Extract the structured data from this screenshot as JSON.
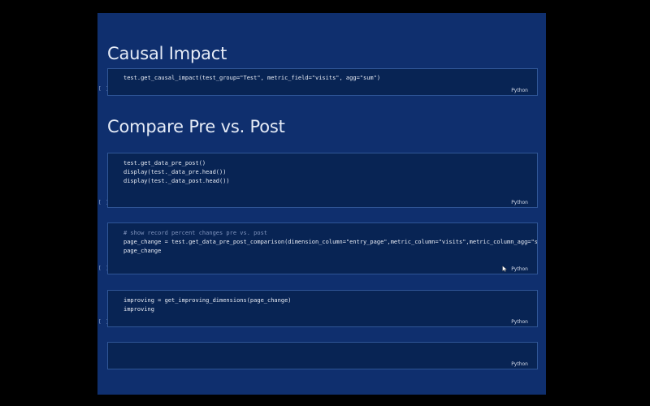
{
  "sections": [
    {
      "heading": "Causal Impact"
    },
    {
      "heading": "Compare Pre vs. Post"
    }
  ],
  "cells": [
    {
      "bracket": "[ ]",
      "lines": [
        "test.get_causal_impact(test_group=\"Test\", metric_field=\"visits\", agg=\"sum\")"
      ],
      "language": "Python"
    },
    {
      "bracket": "[ ]",
      "lines": [
        "test.get_data_pre_post()",
        "display(test._data_pre.head())",
        "display(test._data_post.head())"
      ],
      "language": "Python"
    },
    {
      "bracket": "[ ]",
      "lines": [
        "# show record percent changes pre vs. post",
        "page_change = test.get_data_pre_post_comparison(dimension_column=\"entry_page\",metric_column=\"visits\",metric_column_agg=\"sum",
        "page_change"
      ],
      "language": "Python",
      "icon": "mouse-cursor-icon"
    },
    {
      "bracket": "[ ]",
      "lines": [
        "improving = get_improving_dimensions(page_change)",
        "improving"
      ],
      "language": "Python"
    },
    {
      "bracket": "",
      "lines": [],
      "language": "Python"
    }
  ]
}
